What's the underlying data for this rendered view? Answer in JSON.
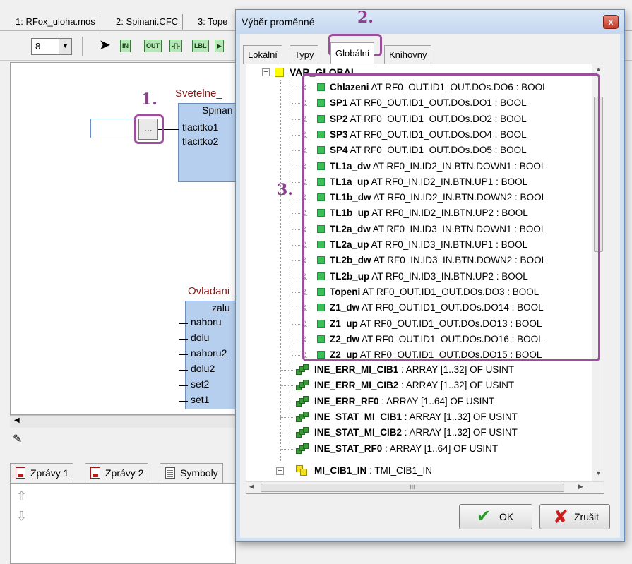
{
  "ide": {
    "file_tabs": [
      "1: RFox_uloha.mos",
      "2: Spinani.CFC",
      "3: Tope"
    ],
    "zoom": "8",
    "toolbar_icons": [
      "arrow-tool-icon",
      "input-block-icon",
      "output-block-icon",
      "box-icon",
      "label-icon",
      "jump-icon"
    ],
    "toolbar_labels": [
      "IN",
      "OUT",
      "-[]-",
      "LBL",
      "▶"
    ],
    "block1": {
      "title": "Svetelne_",
      "name": "Spinan",
      "pins": [
        "tlacitko1",
        "tlacitko2"
      ]
    },
    "block2": {
      "title": "Ovladani_",
      "name": "zalu",
      "pins": [
        "nahoru",
        "dolu",
        "nahoru2",
        "dolu2",
        "set2",
        "set1"
      ]
    },
    "browse_button": "...",
    "bottom_tabs": [
      "Zprávy 1",
      "Zprávy 2",
      "Symboly"
    ]
  },
  "steps": {
    "s1": "1.",
    "s2": "2.",
    "s3": "3."
  },
  "dialog": {
    "title": "Výběr proměnné",
    "close_label": "x",
    "tabs": [
      "Lokální",
      "Typy",
      "Globální",
      "Knihovny"
    ],
    "active_tab": "Globální",
    "root": "VAR_GLOBAL",
    "bool_vars": [
      {
        "name": "Chlazeni",
        "detail": " AT RF0_OUT.ID1_OUT.DOs.DO6 : BOOL"
      },
      {
        "name": "SP1",
        "detail": " AT RF0_OUT.ID1_OUT.DOs.DO1 : BOOL"
      },
      {
        "name": "SP2",
        "detail": " AT RF0_OUT.ID1_OUT.DOs.DO2 : BOOL"
      },
      {
        "name": "SP3",
        "detail": " AT RF0_OUT.ID1_OUT.DOs.DO4 : BOOL"
      },
      {
        "name": "SP4",
        "detail": " AT RF0_OUT.ID1_OUT.DOs.DO5 : BOOL"
      },
      {
        "name": "TL1a_dw",
        "detail": " AT RF0_IN.ID2_IN.BTN.DOWN1 : BOOL"
      },
      {
        "name": "TL1a_up",
        "detail": " AT RF0_IN.ID2_IN.BTN.UP1 : BOOL"
      },
      {
        "name": "TL1b_dw",
        "detail": " AT RF0_IN.ID2_IN.BTN.DOWN2 : BOOL"
      },
      {
        "name": "TL1b_up",
        "detail": " AT RF0_IN.ID2_IN.BTN.UP2 : BOOL"
      },
      {
        "name": "TL2a_dw",
        "detail": " AT RF0_IN.ID3_IN.BTN.DOWN1 : BOOL"
      },
      {
        "name": "TL2a_up",
        "detail": " AT RF0_IN.ID3_IN.BTN.UP1 : BOOL"
      },
      {
        "name": "TL2b_dw",
        "detail": " AT RF0_IN.ID3_IN.BTN.DOWN2 : BOOL"
      },
      {
        "name": "TL2b_up",
        "detail": " AT RF0_IN.ID3_IN.BTN.UP2 : BOOL"
      },
      {
        "name": "Topeni",
        "detail": " AT RF0_OUT.ID1_OUT.DOs.DO3 : BOOL"
      },
      {
        "name": "Z1_dw",
        "detail": " AT RF0_OUT.ID1_OUT.DOs.DO14 : BOOL"
      },
      {
        "name": "Z1_up",
        "detail": " AT RF0_OUT.ID1_OUT.DOs.DO13 : BOOL"
      },
      {
        "name": "Z2_dw",
        "detail": " AT RF0_OUT.ID1_OUT.DOs.DO16 : BOOL"
      },
      {
        "name": "Z2_up",
        "detail": " AT RF0_OUT.ID1_OUT.DOs.DO15 : BOOL"
      }
    ],
    "array_vars": [
      {
        "name": "INE_ERR_MI_CIB1",
        "detail": " : ARRAY [1..32] OF USINT"
      },
      {
        "name": "INE_ERR_MI_CIB2",
        "detail": " : ARRAY [1..32] OF USINT"
      },
      {
        "name": "INE_ERR_RF0",
        "detail": " : ARRAY [1..64] OF USINT"
      },
      {
        "name": "INE_STAT_MI_CIB1",
        "detail": " : ARRAY [1..32] OF USINT"
      },
      {
        "name": "INE_STAT_MI_CIB2",
        "detail": " : ARRAY [1..32] OF USINT"
      },
      {
        "name": "INE_STAT_RF0",
        "detail": " : ARRAY [1..64] OF USINT"
      }
    ],
    "struct_var": {
      "name": "MI_CIB1_IN",
      "detail": " : TMI_CIB1_IN"
    },
    "hscroll_grip": "III",
    "ok_label": "OK",
    "cancel_label": "Zrušit"
  },
  "colors": {
    "accent": "#9c4d9c",
    "bool_icon": "#3bbf58",
    "block_fill": "#b7cfee",
    "ok_icon": "#2a9a2a",
    "cancel_icon": "#c81e1e"
  }
}
